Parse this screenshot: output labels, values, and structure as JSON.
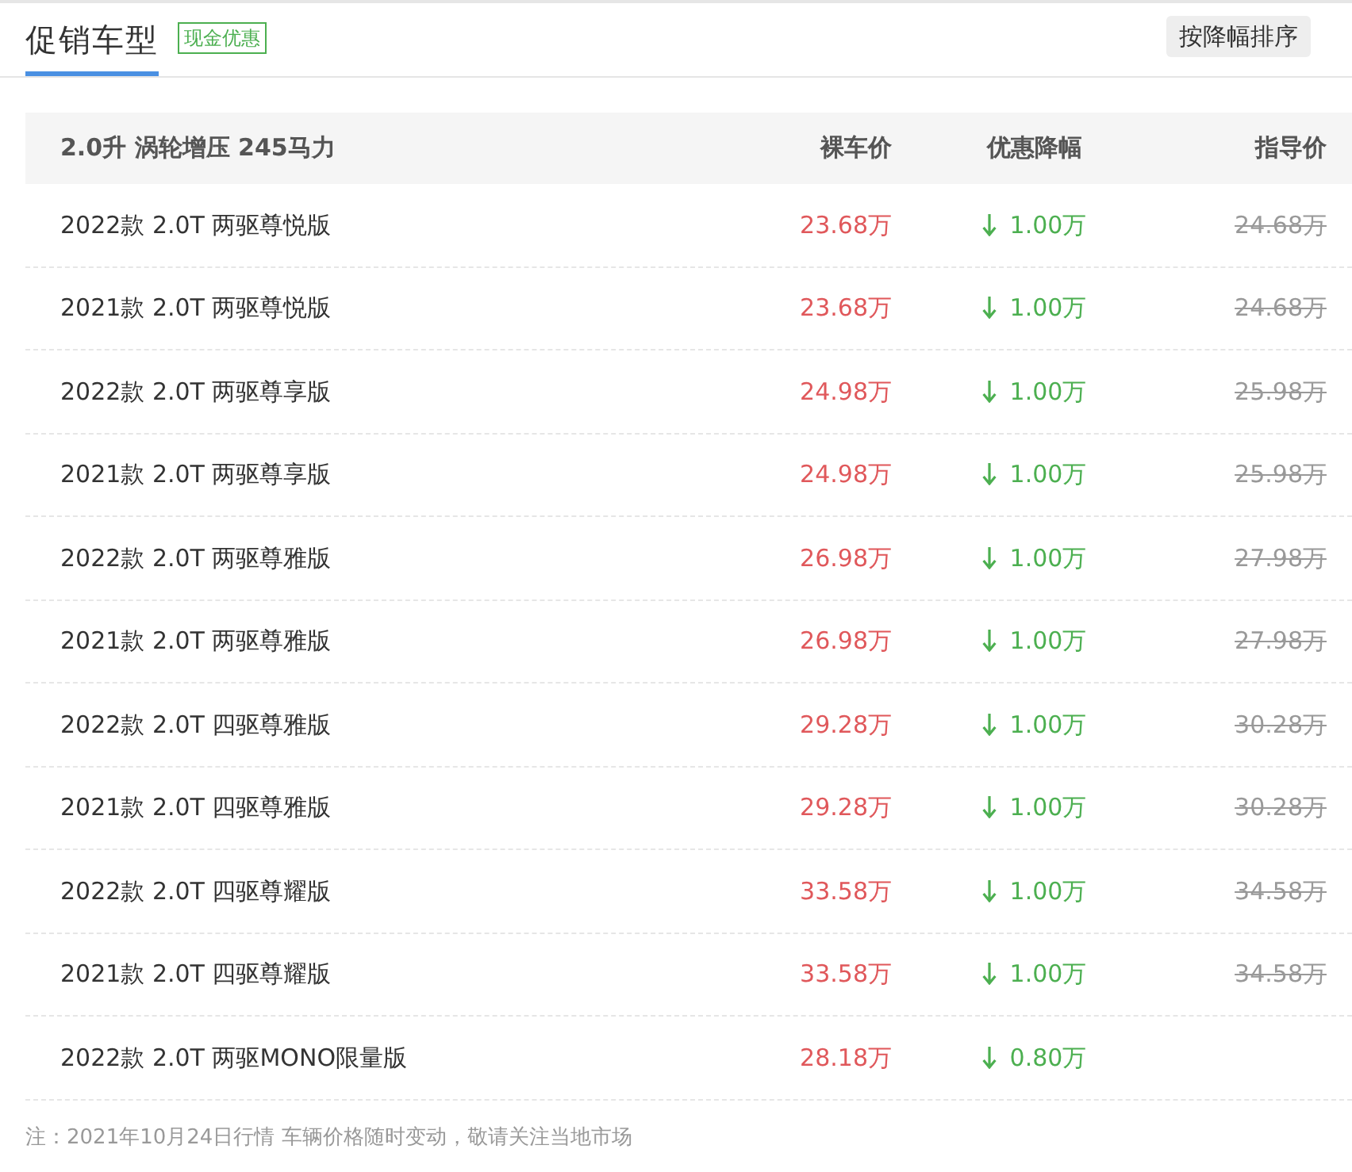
{
  "header": {
    "title": "促销车型",
    "selected": true,
    "tag": "现金优惠",
    "sort_button": "按降幅排序"
  },
  "table": {
    "columns": [
      "2.0升 涡轮增压 245马力",
      "裸车价",
      "优惠降幅",
      "指导价"
    ],
    "rows": [
      {
        "name": "2022款 2.0T 两驱尊悦版",
        "price": "23.68万",
        "discount": "1.00万",
        "guide": "24.68万"
      },
      {
        "name": "2021款 2.0T 两驱尊悦版",
        "price": "23.68万",
        "discount": "1.00万",
        "guide": "24.68万"
      },
      {
        "name": "2022款 2.0T 两驱尊享版",
        "price": "24.98万",
        "discount": "1.00万",
        "guide": "25.98万"
      },
      {
        "name": "2021款 2.0T 两驱尊享版",
        "price": "24.98万",
        "discount": "1.00万",
        "guide": "25.98万"
      },
      {
        "name": "2022款 2.0T 两驱尊雅版",
        "price": "26.98万",
        "discount": "1.00万",
        "guide": "27.98万"
      },
      {
        "name": "2021款 2.0T 两驱尊雅版",
        "price": "26.98万",
        "discount": "1.00万",
        "guide": "27.98万"
      },
      {
        "name": "2022款 2.0T 四驱尊雅版",
        "price": "29.28万",
        "discount": "1.00万",
        "guide": "30.28万"
      },
      {
        "name": "2021款 2.0T 四驱尊雅版",
        "price": "29.28万",
        "discount": "1.00万",
        "guide": "30.28万"
      },
      {
        "name": "2022款 2.0T 四驱尊耀版",
        "price": "33.58万",
        "discount": "1.00万",
        "guide": "34.58万"
      },
      {
        "name": "2021款 2.0T 四驱尊耀版",
        "price": "33.58万",
        "discount": "1.00万",
        "guide": "34.58万"
      },
      {
        "name": "2022款 2.0T 两驱MONO限量版",
        "price": "28.18万",
        "discount": "0.80万"
      }
    ]
  },
  "note": "注：2021年10月24日行情 车辆价格随时变动，敬请关注当地市场"
}
